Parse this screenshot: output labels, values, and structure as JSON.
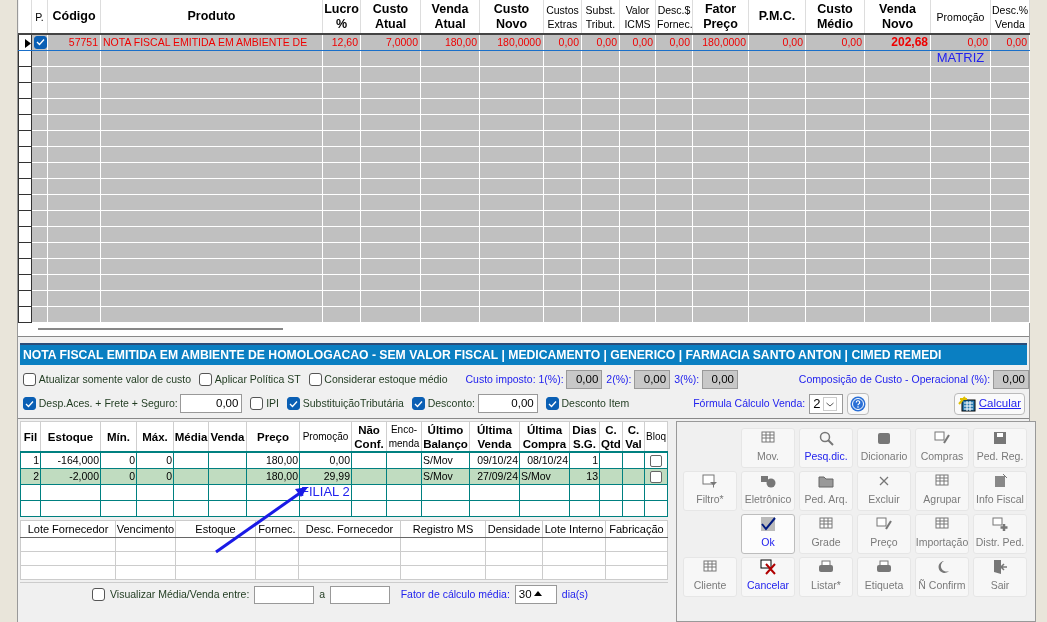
{
  "top_grid": {
    "columns": [
      "P.",
      "Código",
      "Produto",
      "Lucro\n%",
      "Custo\nAtual",
      "Venda\nAtual",
      "Custo\nNovo",
      "Custos\nExtras",
      "Subst.\nTribut.",
      "Valor\nICMS",
      "Desc.$\nFornec.",
      "Fator\nPreço",
      "P.M.C.",
      "Custo\nMédio",
      "Venda\nNovo",
      "Promoção",
      "Desc.%\nVenda"
    ],
    "rows": [
      {
        "selected": true,
        "checked": true,
        "cells": [
          "",
          "57751",
          "NOTA FISCAL EMITIDA EM AMBIENTE DE",
          "12,60",
          "7,0000",
          "180,00",
          "180,0000",
          "0,00",
          "0,00",
          "0,00",
          "0,00",
          "180,0000",
          "0,00",
          "0,00",
          "202,68",
          "0,00",
          "0,00"
        ]
      }
    ],
    "annotation": "MATRIZ"
  },
  "banner": "NOTA FISCAL EMITIDA EM AMBIENTE DE HOMOLOGACAO - SEM VALOR FISCAL | MEDICAMENTO | GENERICO | FARMACIA SANTO ANTON | CIMED REMEDI",
  "options_row_1": [
    {
      "kind": "check",
      "label": "Atualizar somente valor de custo",
      "checked": false
    },
    {
      "kind": "check",
      "label": "Aplicar Política ST",
      "checked": false
    },
    {
      "kind": "check",
      "label": "Considerar estoque médio",
      "checked": false
    },
    {
      "kind": "readonly",
      "label": "Custo imposto: 1(%):",
      "value": "0,00"
    },
    {
      "kind": "readonly",
      "label": "2(%):",
      "value": "0,00"
    },
    {
      "kind": "readonly",
      "label": "3(%):",
      "value": "0,00"
    },
    {
      "kind": "readonly",
      "label": "Composição de Custo - Operacional (%):",
      "value": "0,00"
    }
  ],
  "options_row_2": [
    {
      "kind": "check",
      "label": "Desp.Aces. + Frete + Seguro:",
      "checked": true,
      "value": "0,00"
    },
    {
      "kind": "check",
      "label": "IPI",
      "checked": false
    },
    {
      "kind": "check",
      "label": "SubstituiçãoTributária",
      "checked": true
    },
    {
      "kind": "check",
      "label": "Desconto:",
      "checked": true,
      "value": "0,00"
    },
    {
      "kind": "check",
      "label": "Desconto Item",
      "checked": true
    },
    {
      "kind": "select",
      "label": "Fórmula Cálculo Venda:",
      "value": "2"
    },
    {
      "kind": "help"
    },
    {
      "kind": "button",
      "label": "Calcular"
    }
  ],
  "branch_grid": {
    "columns": [
      "Fil",
      "Estoque",
      "Mín.",
      "Máx.",
      "Média",
      "Venda",
      "Preço",
      "Promoção",
      "Não\nConf.",
      "Enco-\nmenda",
      "Último\nBalanço",
      "Última\nVenda",
      "Última\nCompra",
      "Dias\nS.G.",
      "C.\nQtd",
      "C.\nVal",
      "Bloq"
    ],
    "rows": [
      {
        "selected": false,
        "blocked": false,
        "cells": [
          "1",
          "-164,000",
          "0",
          "0",
          "",
          "",
          "180,00",
          "0,00",
          "",
          "",
          "S/Mov",
          "09/10/24",
          "08/10/24",
          "1",
          "",
          ""
        ]
      },
      {
        "selected": true,
        "blocked": false,
        "cells": [
          "2",
          "-2,000",
          "0",
          "0",
          "",
          "",
          "180,00",
          "29,99",
          "",
          "",
          "S/Mov",
          "27/09/24",
          "S/Mov",
          "13",
          "",
          ""
        ]
      }
    ],
    "annotation": "FILIAL 2"
  },
  "lot_table": {
    "columns": [
      "Lote Fornecedor",
      "Vencimento",
      "Estoque",
      "Fornec.",
      "Desc. Fornecedor",
      "Registro MS",
      "Densidade",
      "Lote Interno",
      "Fabricação"
    ]
  },
  "average_row": {
    "checkbox_label": "Visualizar Média/Venda entre:",
    "checked": false,
    "separator": "a",
    "factor_label": "Fator de cálculo média:",
    "factor_value": "30",
    "unit": "dia(s)"
  },
  "toolbar": [
    [
      {
        "label": "Mov.",
        "disabled": true,
        "focused": false
      },
      {
        "label": "Pesq.dic.",
        "disabled": false,
        "focused": false
      },
      {
        "label": "Dicionario",
        "disabled": true,
        "focused": false
      },
      {
        "label": "Compras",
        "disabled": true,
        "focused": false
      },
      {
        "label": "Ped. Reg.",
        "disabled": true,
        "focused": false
      }
    ],
    [
      {
        "label": "Filtro*",
        "disabled": true,
        "focused": false
      },
      {
        "label": "Eletrônico",
        "disabled": true,
        "focused": false
      },
      {
        "label": "Ped. Arq.",
        "disabled": true,
        "focused": false
      },
      {
        "label": "Excluir",
        "disabled": true,
        "focused": false
      },
      {
        "label": "Agrupar",
        "disabled": true,
        "focused": false
      },
      {
        "label": "Info Fiscal",
        "disabled": true,
        "focused": false
      }
    ],
    [
      {
        "label": "Ok",
        "disabled": false,
        "focused": true
      },
      {
        "label": "Grade",
        "disabled": true,
        "focused": false
      },
      {
        "label": "Preço",
        "disabled": true,
        "focused": false
      },
      {
        "label": "Importação",
        "disabled": true,
        "focused": false
      },
      {
        "label": "Distr. Ped.",
        "disabled": true,
        "focused": false
      }
    ],
    [
      {
        "label": "Cliente",
        "disabled": true,
        "focused": false
      },
      {
        "label": "Cancelar",
        "disabled": false,
        "focused": false
      },
      {
        "label": "Listar*",
        "disabled": true,
        "focused": false
      },
      {
        "label": "Etiqueta",
        "disabled": true,
        "focused": false
      },
      {
        "label": "Ñ Confirm",
        "disabled": true,
        "focused": false
      },
      {
        "label": "Sair",
        "disabled": true,
        "focused": false
      }
    ]
  ]
}
